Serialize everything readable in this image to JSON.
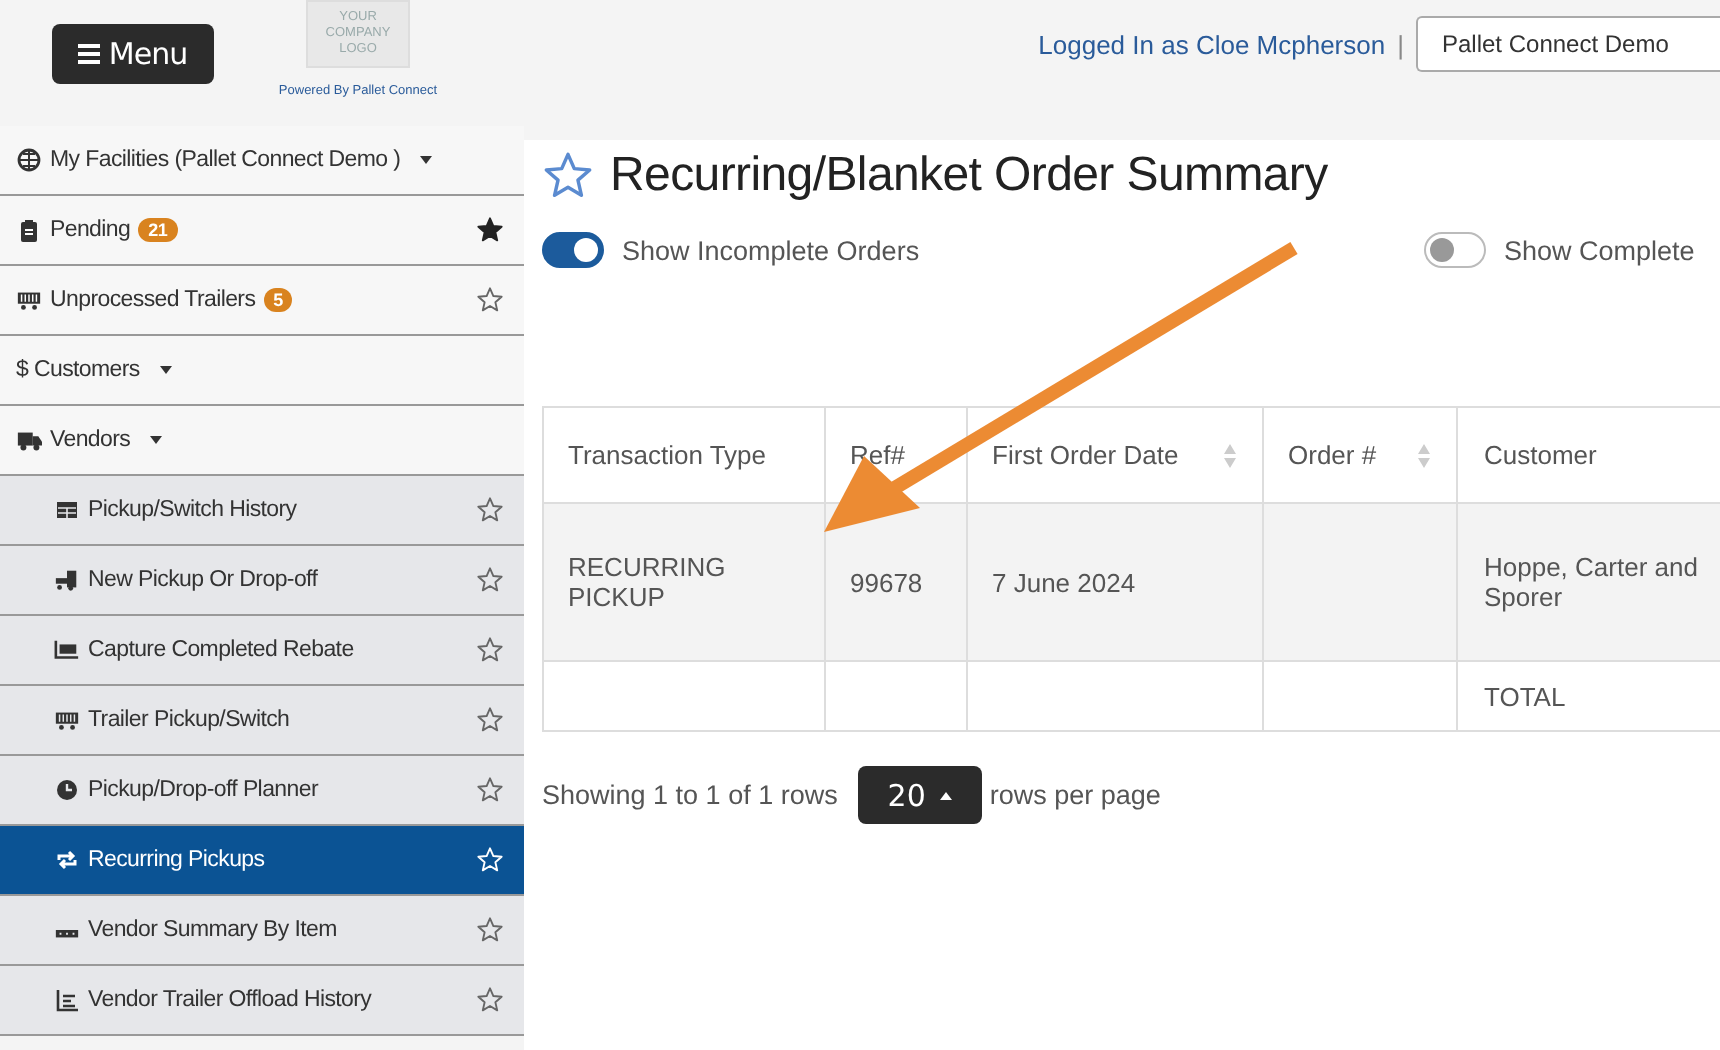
{
  "header": {
    "menu_button": "Menu",
    "logo": {
      "lines": [
        "YOUR",
        "COMPANY",
        "LOGO"
      ],
      "caption": "Powered By Pallet Connect"
    },
    "user": "Logged In as Cloe Mcpherson",
    "separator": "|",
    "company_select": "Pallet Connect Demo"
  },
  "sidebar": {
    "items": [
      {
        "kind": "dropdown",
        "label": "My Facilities (Pallet Connect Demo )",
        "selected": false
      },
      {
        "kind": "link",
        "label": "Pending",
        "badge": "21",
        "starred": true,
        "selected": false
      },
      {
        "kind": "link",
        "label": "Unprocessed Trailers",
        "badge": "5",
        "starred": false,
        "selected": false
      },
      {
        "kind": "dropdown",
        "label": "$ Customers",
        "selected": false
      },
      {
        "kind": "dropdown",
        "label": "Vendors",
        "selected": false,
        "children": [
          {
            "label": "Pickup/Switch History",
            "starred": false,
            "selected": false
          },
          {
            "label": "New Pickup Or Drop-off",
            "starred": false,
            "selected": false
          },
          {
            "label": "Capture Completed Rebate",
            "starred": false,
            "selected": false
          },
          {
            "label": "Trailer Pickup/Switch",
            "starred": false,
            "selected": false
          },
          {
            "label": "Pickup/Drop-off Planner",
            "starred": false,
            "selected": false
          },
          {
            "label": "Recurring Pickups",
            "starred": false,
            "selected": true
          },
          {
            "label": "Vendor Summary By Item",
            "starred": false,
            "selected": false
          },
          {
            "label": "Vendor Trailer Offload History",
            "starred": false,
            "selected": false
          }
        ]
      }
    ]
  },
  "page": {
    "title": "Recurring/Blanket Order Summary",
    "starred": false,
    "toggles": [
      {
        "label": "Show Incomplete Orders",
        "on": true
      },
      {
        "label": "Show Complete",
        "on": false
      }
    ]
  },
  "table": {
    "columns": [
      {
        "label": "Transaction Type",
        "sortable": false
      },
      {
        "label": "Ref#",
        "sortable": false
      },
      {
        "label": "First Order Date",
        "sortable": true
      },
      {
        "label": "Order #",
        "sortable": true
      },
      {
        "label": "Customer",
        "sortable": false
      }
    ],
    "rows": [
      {
        "kind": "data",
        "cells": [
          "RECURRING PICKUP",
          "99678",
          "7 June 2024",
          "",
          "Hoppe, Carter and Sporer"
        ]
      },
      {
        "kind": "total",
        "cells": [
          "",
          "",
          "",
          "",
          "TOTAL"
        ]
      }
    ]
  },
  "pagination": {
    "summary": "Showing 1 to 1 of 1 rows",
    "page_size": "20",
    "suffix": "rows per page"
  },
  "annotation": {
    "kind": "arrow"
  }
}
